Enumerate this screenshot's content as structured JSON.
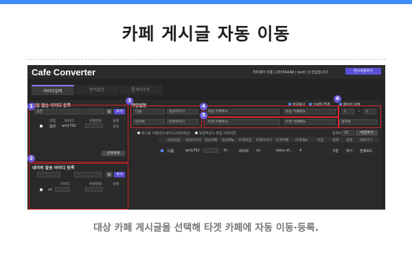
{
  "page": {
    "title": "카페 게시글 자동 이동",
    "caption": "대상 카페 게시글을 선택해 타겟 카페에 자동 이동·등록."
  },
  "app": {
    "logo_part1": "Cafe",
    "logo_part2": " Converter",
    "user_info": "하트웨어 이름 | 255E4AAB | test1 님 반갑습니다!",
    "header_button": "연구자용하기",
    "tabs": [
      "아이디입력",
      "편의옵션",
      "통계리스트"
    ],
    "source_panel": {
      "title": "다음 발송 아이디 등록",
      "id_select": "일반",
      "add_button": "추가",
      "columns": [
        "타입",
        "아이디",
        "비밀번호",
        "상태"
      ],
      "rows": [
        {
          "type": "일반",
          "id": "am1752",
          "password": "",
          "status": "성공"
        }
      ],
      "delete_button": "선택삭제"
    },
    "naver_panel": {
      "title": "네이버 발송 아이디 등록",
      "add_button": "추가",
      "columns": [
        "아이디",
        "비밀번호",
        "상태"
      ],
      "rows": [
        {
          "id": "co",
          "password": "",
          "status": ""
        }
      ]
    },
    "work": {
      "title": "작업설정",
      "source_site": "다음",
      "source_id": "대상아이디",
      "target_site": "네이버",
      "target_id": "타겟아이디",
      "source_cafe_url": "대상 카페주소",
      "source_board": "대상 카페메뉴",
      "target_cafe_url": "타겟 카페주소",
      "target_board": "타겟 카페메뉴",
      "option_copy": "댓글복사",
      "option_nickname": "닉네임 변경",
      "page_setting": "페이지 설정",
      "page_from": "1",
      "page_sep": "~",
      "page_to": "1",
      "sort_select": "일여관",
      "delay_label": "딜레이",
      "delay_value": "10",
      "add_task_button": "작업추가",
      "extra_option_1": "태그링 사용(안드로이드/iOS대상)",
      "extra_option_2": "댓글작성시 편집 이모티콘",
      "table_columns": [
        "대상타입",
        "대상아이디",
        "대상카페",
        "대상메뉴",
        "타겟타입",
        "타겟아이디",
        "타겟카페",
        "타겟메뉴",
        "타입",
        "삼태",
        "설명",
        "바로가기"
      ],
      "table_rows": [
        {
          "cells": [
            "다음",
            "am1752",
            "",
            "th",
            "네이버",
            "co",
            "story of...",
            "4",
            "",
            "기준",
            "여기",
            "전체모드"
          ]
        }
      ]
    }
  },
  "annotations": [
    "1",
    "2",
    "3",
    "4",
    "5",
    "6"
  ],
  "colors": {
    "accent": "#3d8bf5",
    "annotation_red": "#e0252b",
    "badge_purple": "#6a5bd8",
    "app_background": "#232323"
  }
}
